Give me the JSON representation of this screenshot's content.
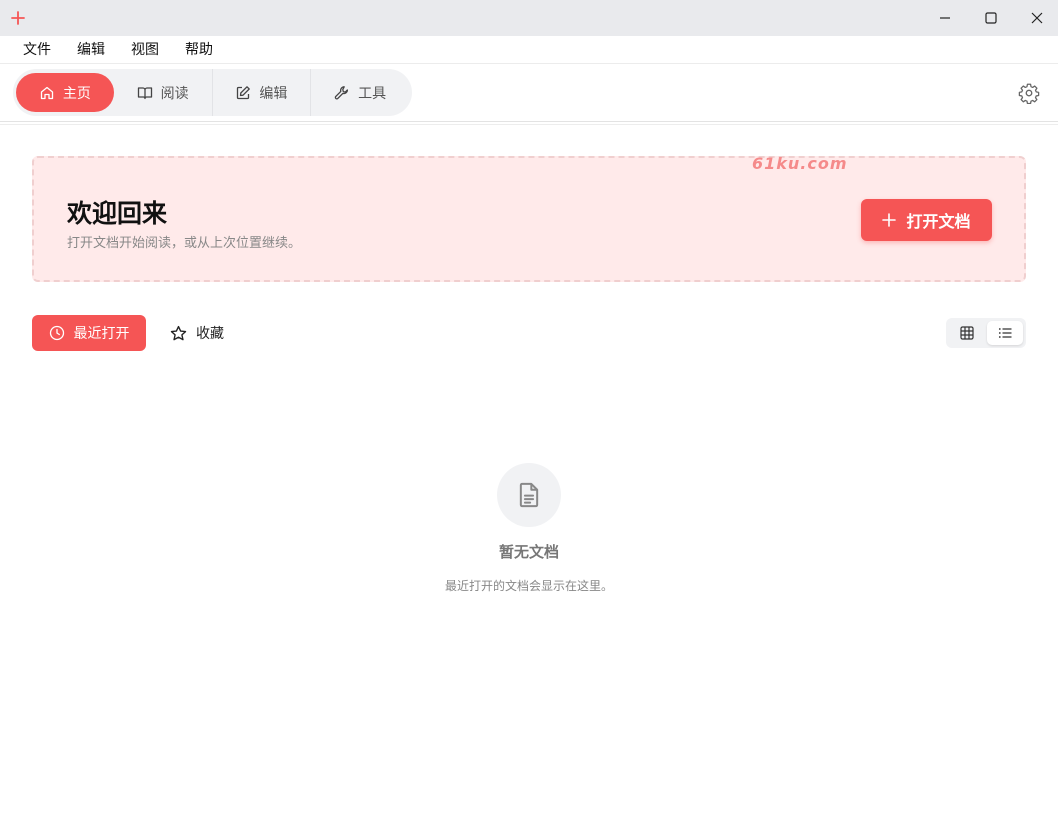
{
  "window": {
    "minimize_icon": "minimize-icon",
    "maximize_icon": "maximize-icon",
    "close_icon": "close-icon",
    "app_icon": "plus-icon",
    "accent": "#f55555"
  },
  "menu": {
    "items": [
      {
        "label": "文件"
      },
      {
        "label": "编辑"
      },
      {
        "label": "视图"
      },
      {
        "label": "帮助"
      }
    ]
  },
  "toolbar": {
    "tabs": [
      {
        "label": "主页",
        "icon": "home-icon",
        "active": true
      },
      {
        "label": "阅读",
        "icon": "book-icon",
        "active": false
      },
      {
        "label": "编辑",
        "icon": "edit-icon",
        "active": false
      },
      {
        "label": "工具",
        "icon": "wrench-icon",
        "active": false
      }
    ],
    "settings_icon": "gear-icon"
  },
  "banner": {
    "title": "欢迎回来",
    "subtitle": "打开文档开始阅读，或从上次位置继续。",
    "open_button": "打开文档",
    "watermark": "61ku.com",
    "background": "#ffeaea"
  },
  "filters": {
    "recent": "最近打开",
    "favorites": "收藏",
    "view_mode": "list"
  },
  "empty_state": {
    "title": "暂无文档",
    "subtitle": "最近打开的文档会显示在这里。",
    "icon": "document-icon"
  }
}
